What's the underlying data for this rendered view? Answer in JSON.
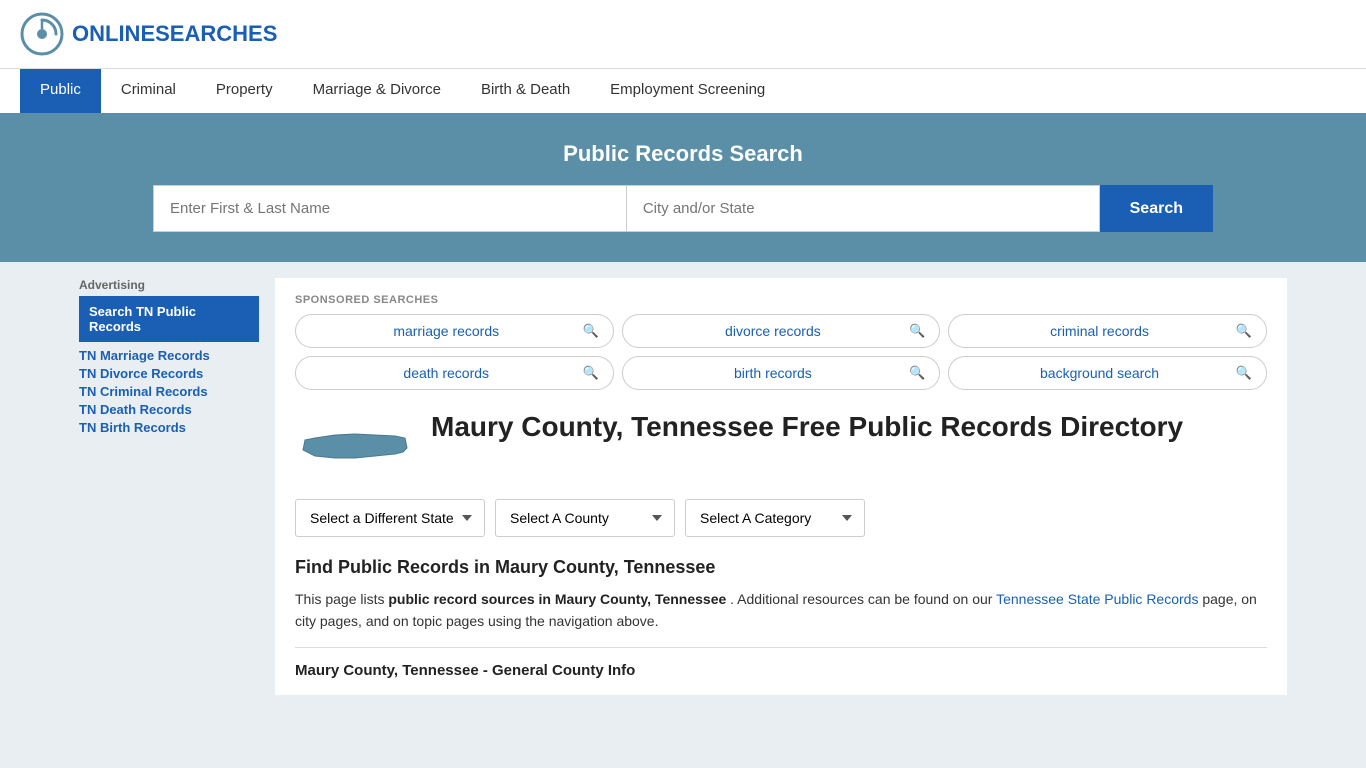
{
  "header": {
    "logo_text_plain": "ONLINE",
    "logo_text_accent": "SEARCHES"
  },
  "nav": {
    "items": [
      {
        "label": "Public",
        "active": true
      },
      {
        "label": "Criminal",
        "active": false
      },
      {
        "label": "Property",
        "active": false
      },
      {
        "label": "Marriage & Divorce",
        "active": false
      },
      {
        "label": "Birth & Death",
        "active": false
      },
      {
        "label": "Employment Screening",
        "active": false
      }
    ]
  },
  "hero": {
    "title": "Public Records Search",
    "name_placeholder": "Enter First & Last Name",
    "location_placeholder": "City and/or State",
    "search_button": "Search"
  },
  "sponsored": {
    "label": "SPONSORED SEARCHES",
    "pills": [
      {
        "text": "marriage records"
      },
      {
        "text": "divorce records"
      },
      {
        "text": "criminal records"
      },
      {
        "text": "death records"
      },
      {
        "text": "birth records"
      },
      {
        "text": "background search"
      }
    ]
  },
  "page": {
    "title": "Maury County, Tennessee Free Public Records Directory",
    "dropdowns": {
      "state_label": "Select a Different State",
      "county_label": "Select A County",
      "category_label": "Select A Category"
    },
    "find_title": "Find Public Records in Maury County, Tennessee",
    "find_text_intro": "This page lists",
    "find_text_bold": "public record sources in Maury County, Tennessee",
    "find_text_mid": ". Additional resources can be found on our",
    "find_link": "Tennessee State Public Records",
    "find_text_end": "page, on city pages, and on topic pages using the navigation above.",
    "general_info_title": "Maury County, Tennessee - General County Info"
  },
  "sidebar": {
    "ad_label": "Advertising",
    "ad_block_text": "Search TN Public Records",
    "links": [
      {
        "text": "TN Marriage Records"
      },
      {
        "text": "TN Divorce Records"
      },
      {
        "text": "TN Criminal Records"
      },
      {
        "text": "TN Death Records"
      },
      {
        "text": "TN Birth Records"
      }
    ]
  }
}
